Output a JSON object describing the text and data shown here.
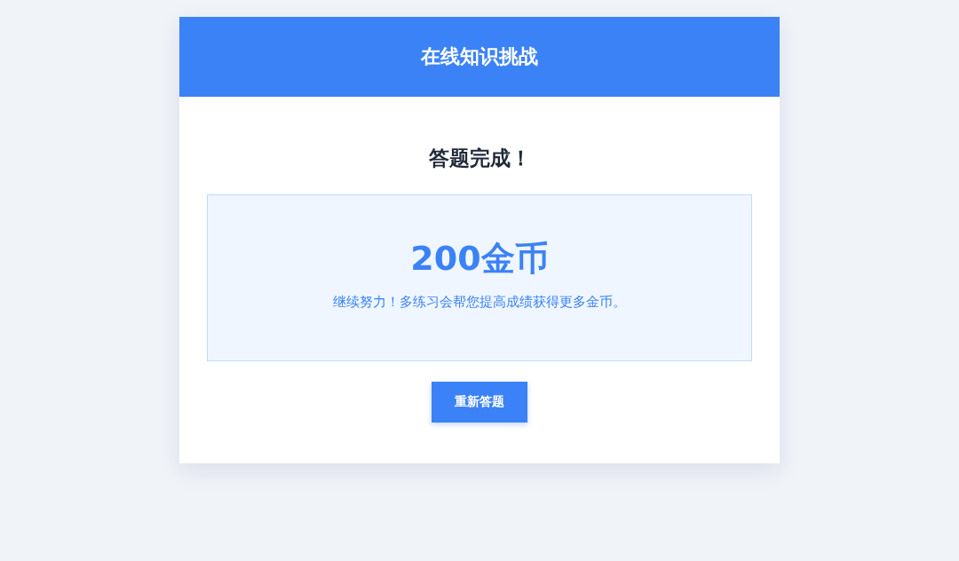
{
  "header": {
    "title": "在线知识挑战"
  },
  "result": {
    "heading": "答题完成！",
    "score": "200金币",
    "message": "继续努力！多练习会帮您提高成绩获得更多金币。"
  },
  "buttons": [
    {
      "label": "重新答题"
    }
  ]
}
